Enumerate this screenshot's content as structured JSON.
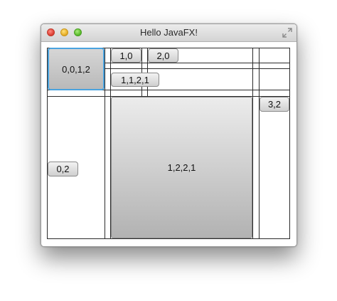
{
  "window": {
    "title": "Hello JavaFX!"
  },
  "buttons": {
    "b_0_0_1_2": "0,0,1,2",
    "b_1_0": "1,0",
    "b_2_0": "2,0",
    "b_1_1_2_1": "1,1,2,1",
    "b_3_2": "3,2",
    "b_0_2": "0,2",
    "b_1_2_2_1": "1,2,2,1"
  },
  "icons": {
    "fullscreen": "fullscreen-arrows-icon"
  },
  "colors": {
    "focus_ring": "#4aa3df",
    "close": "#e0443a",
    "minimize": "#e9b12e",
    "zoom": "#5fbf2f"
  }
}
